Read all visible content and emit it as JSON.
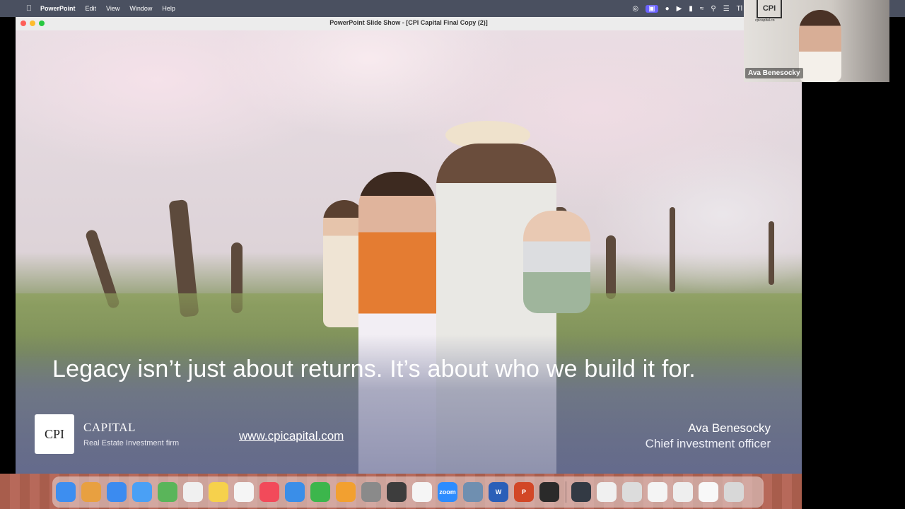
{
  "menubar": {
    "app_name": "PowerPoint",
    "menus": [
      "Edit",
      "View",
      "Window",
      "Help"
    ],
    "clock_fragment": "Tl"
  },
  "window": {
    "title": "PowerPoint Slide Show - [CPI Capital Final Copy (2)]"
  },
  "slide": {
    "quote": "Legacy isn’t just about returns. It’s about who we build it for.",
    "logo_text": "CPI",
    "capital_label": "CAPITAL",
    "tagline": "Real Estate Investment firm",
    "url": "www.cpicapital.com",
    "presenter_name": "Ava Benesocky",
    "presenter_title": "Chief investment officer"
  },
  "video": {
    "participant_name": "Ava Benesocky",
    "wall_logo": "CPI",
    "wall_site": "cpicapital.co"
  },
  "dock": {
    "apps": [
      {
        "name": "finder",
        "color": "#3d8ef0",
        "label": ""
      },
      {
        "name": "launchpad",
        "color": "#e8a040",
        "label": ""
      },
      {
        "name": "safari",
        "color": "#3b8bf0",
        "label": ""
      },
      {
        "name": "mail",
        "color": "#4aa0f5",
        "label": ""
      },
      {
        "name": "maps",
        "color": "#5ab55a",
        "label": ""
      },
      {
        "name": "reminders",
        "color": "#f0f0f0",
        "label": ""
      },
      {
        "name": "notes",
        "color": "#f6d14c",
        "label": ""
      },
      {
        "name": "freeform",
        "color": "#f5f5f5",
        "label": ""
      },
      {
        "name": "news",
        "color": "#f24a5a",
        "label": ""
      },
      {
        "name": "keynote",
        "color": "#3a8ee8",
        "label": ""
      },
      {
        "name": "numbers",
        "color": "#3cb64c",
        "label": ""
      },
      {
        "name": "pages",
        "color": "#f2a030",
        "label": ""
      },
      {
        "name": "system-settings",
        "color": "#8a8a8a",
        "label": ""
      },
      {
        "name": "iphone-mirroring",
        "color": "#3d3d3d",
        "label": ""
      },
      {
        "name": "asana",
        "color": "#f5f5f5",
        "label": ""
      },
      {
        "name": "zoom",
        "color": "#2d8cff",
        "label": "zoom"
      },
      {
        "name": "preview",
        "color": "#6f8fb0",
        "label": ""
      },
      {
        "name": "word",
        "color": "#2b5fb8",
        "label": "W"
      },
      {
        "name": "powerpoint",
        "color": "#d24726",
        "label": "P"
      },
      {
        "name": "obs",
        "color": "#2a2a2a",
        "label": ""
      }
    ],
    "recents": [
      {
        "name": "recent-window-1",
        "color": "#333a44"
      },
      {
        "name": "recent-window-2",
        "color": "#f0f0f0"
      },
      {
        "name": "recent-window-3",
        "color": "#dcdcdc"
      },
      {
        "name": "recent-window-4",
        "color": "#f4f4f4"
      },
      {
        "name": "recent-window-5",
        "color": "#eeeeee"
      },
      {
        "name": "recent-window-6",
        "color": "#f8f8f8"
      },
      {
        "name": "trash",
        "color": "#d8d8d8"
      }
    ]
  }
}
